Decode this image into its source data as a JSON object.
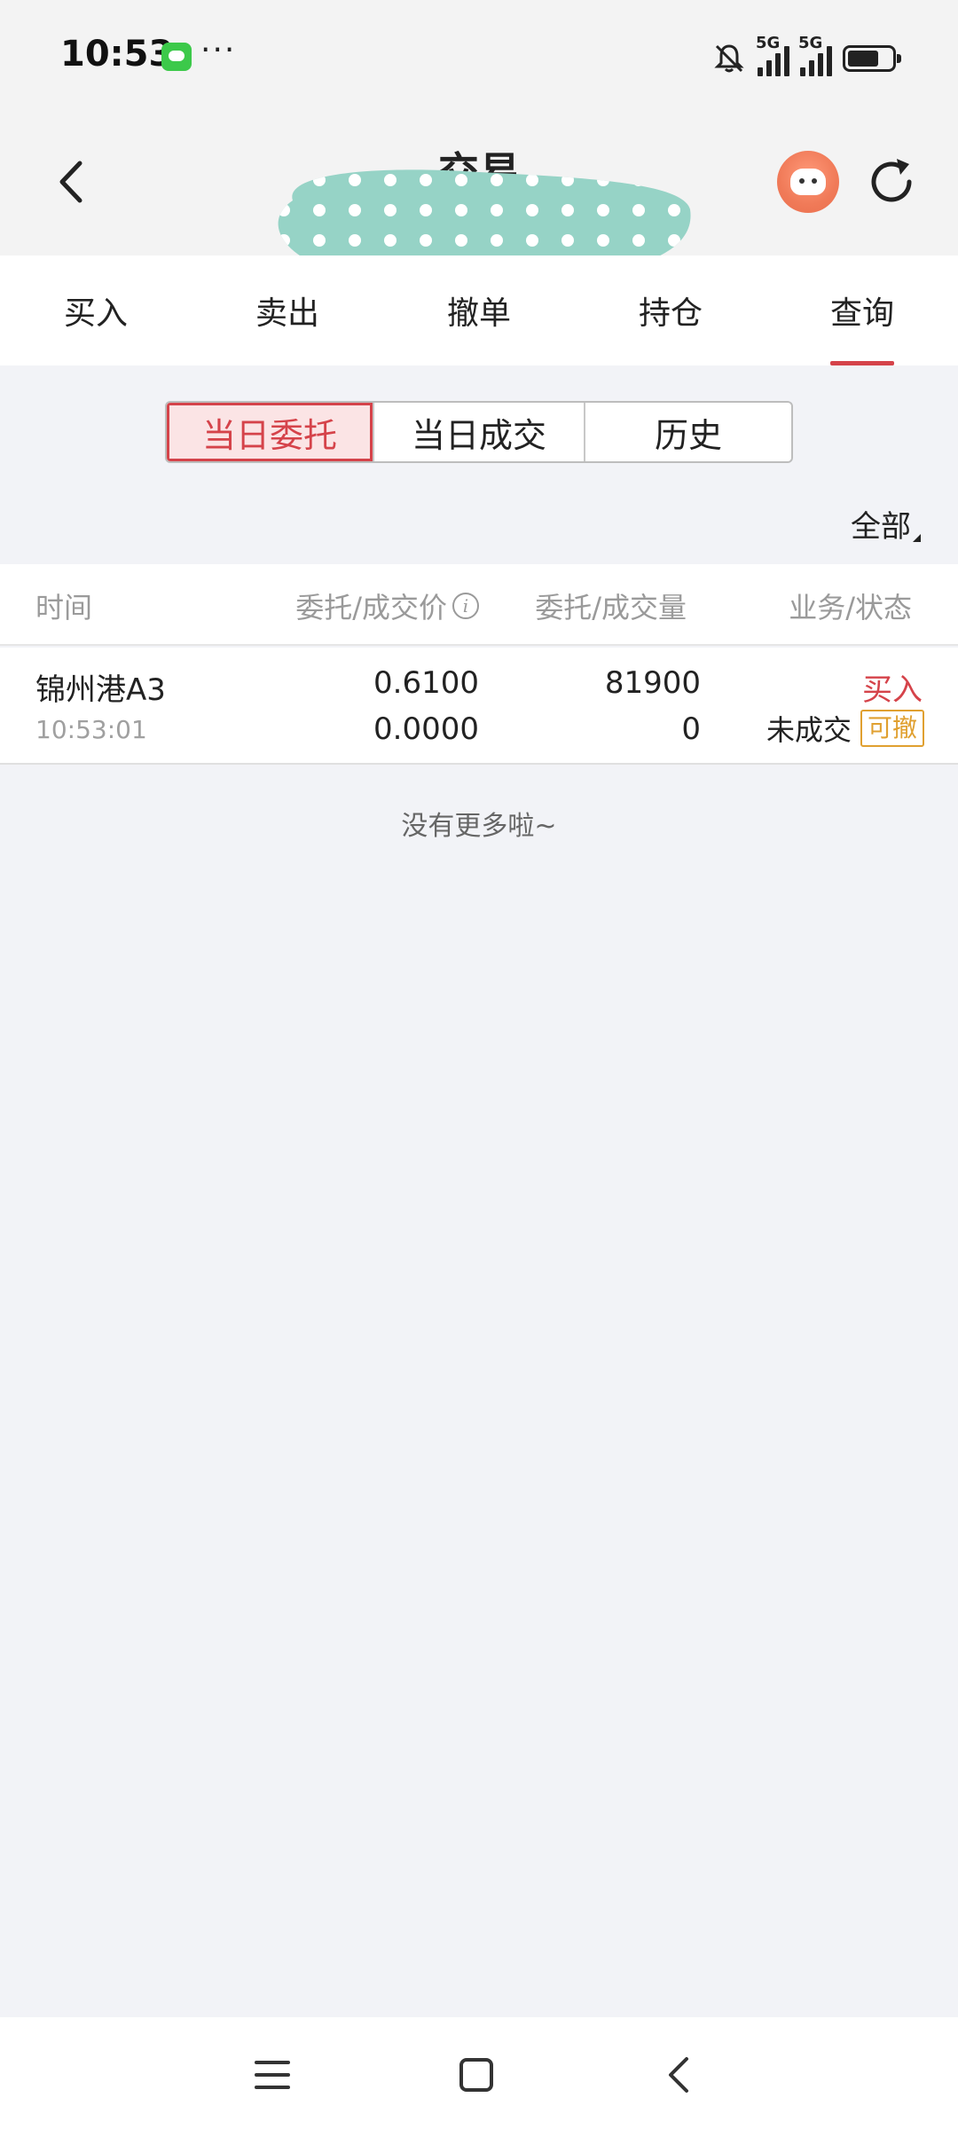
{
  "status_bar": {
    "time": "10:53",
    "more": "···",
    "network_1": "5G",
    "network_2": "5G",
    "icons": [
      "chat-app-icon",
      "mute-icon",
      "signal-icon",
      "signal-icon",
      "battery-icon"
    ]
  },
  "header": {
    "title": "交易",
    "icons": [
      "back-icon",
      "avatar-icon",
      "refresh-icon"
    ]
  },
  "tabs": [
    {
      "label": "买入"
    },
    {
      "label": "卖出"
    },
    {
      "label": "撤单"
    },
    {
      "label": "持仓"
    },
    {
      "label": "查询",
      "active": true
    }
  ],
  "segments": [
    {
      "label": "当日委托",
      "active": true
    },
    {
      "label": "当日成交"
    },
    {
      "label": "历史"
    }
  ],
  "filter": {
    "label": "全部"
  },
  "table": {
    "headers": {
      "time": "时间",
      "price": "委托/成交价",
      "qty": "委托/成交量",
      "status": "业务/状态"
    },
    "rows": [
      {
        "name": "锦州港A3",
        "time": "10:53:01",
        "order_price": "0.6100",
        "deal_price": "0.0000",
        "order_qty": "81900",
        "deal_qty": "0",
        "side": "买入",
        "state": "未成交",
        "action": "可撤"
      }
    ]
  },
  "footer_text": "没有更多啦~",
  "colors": {
    "accent": "#d5434a",
    "badge": "#e0a030",
    "background": "#f2f3f7"
  }
}
